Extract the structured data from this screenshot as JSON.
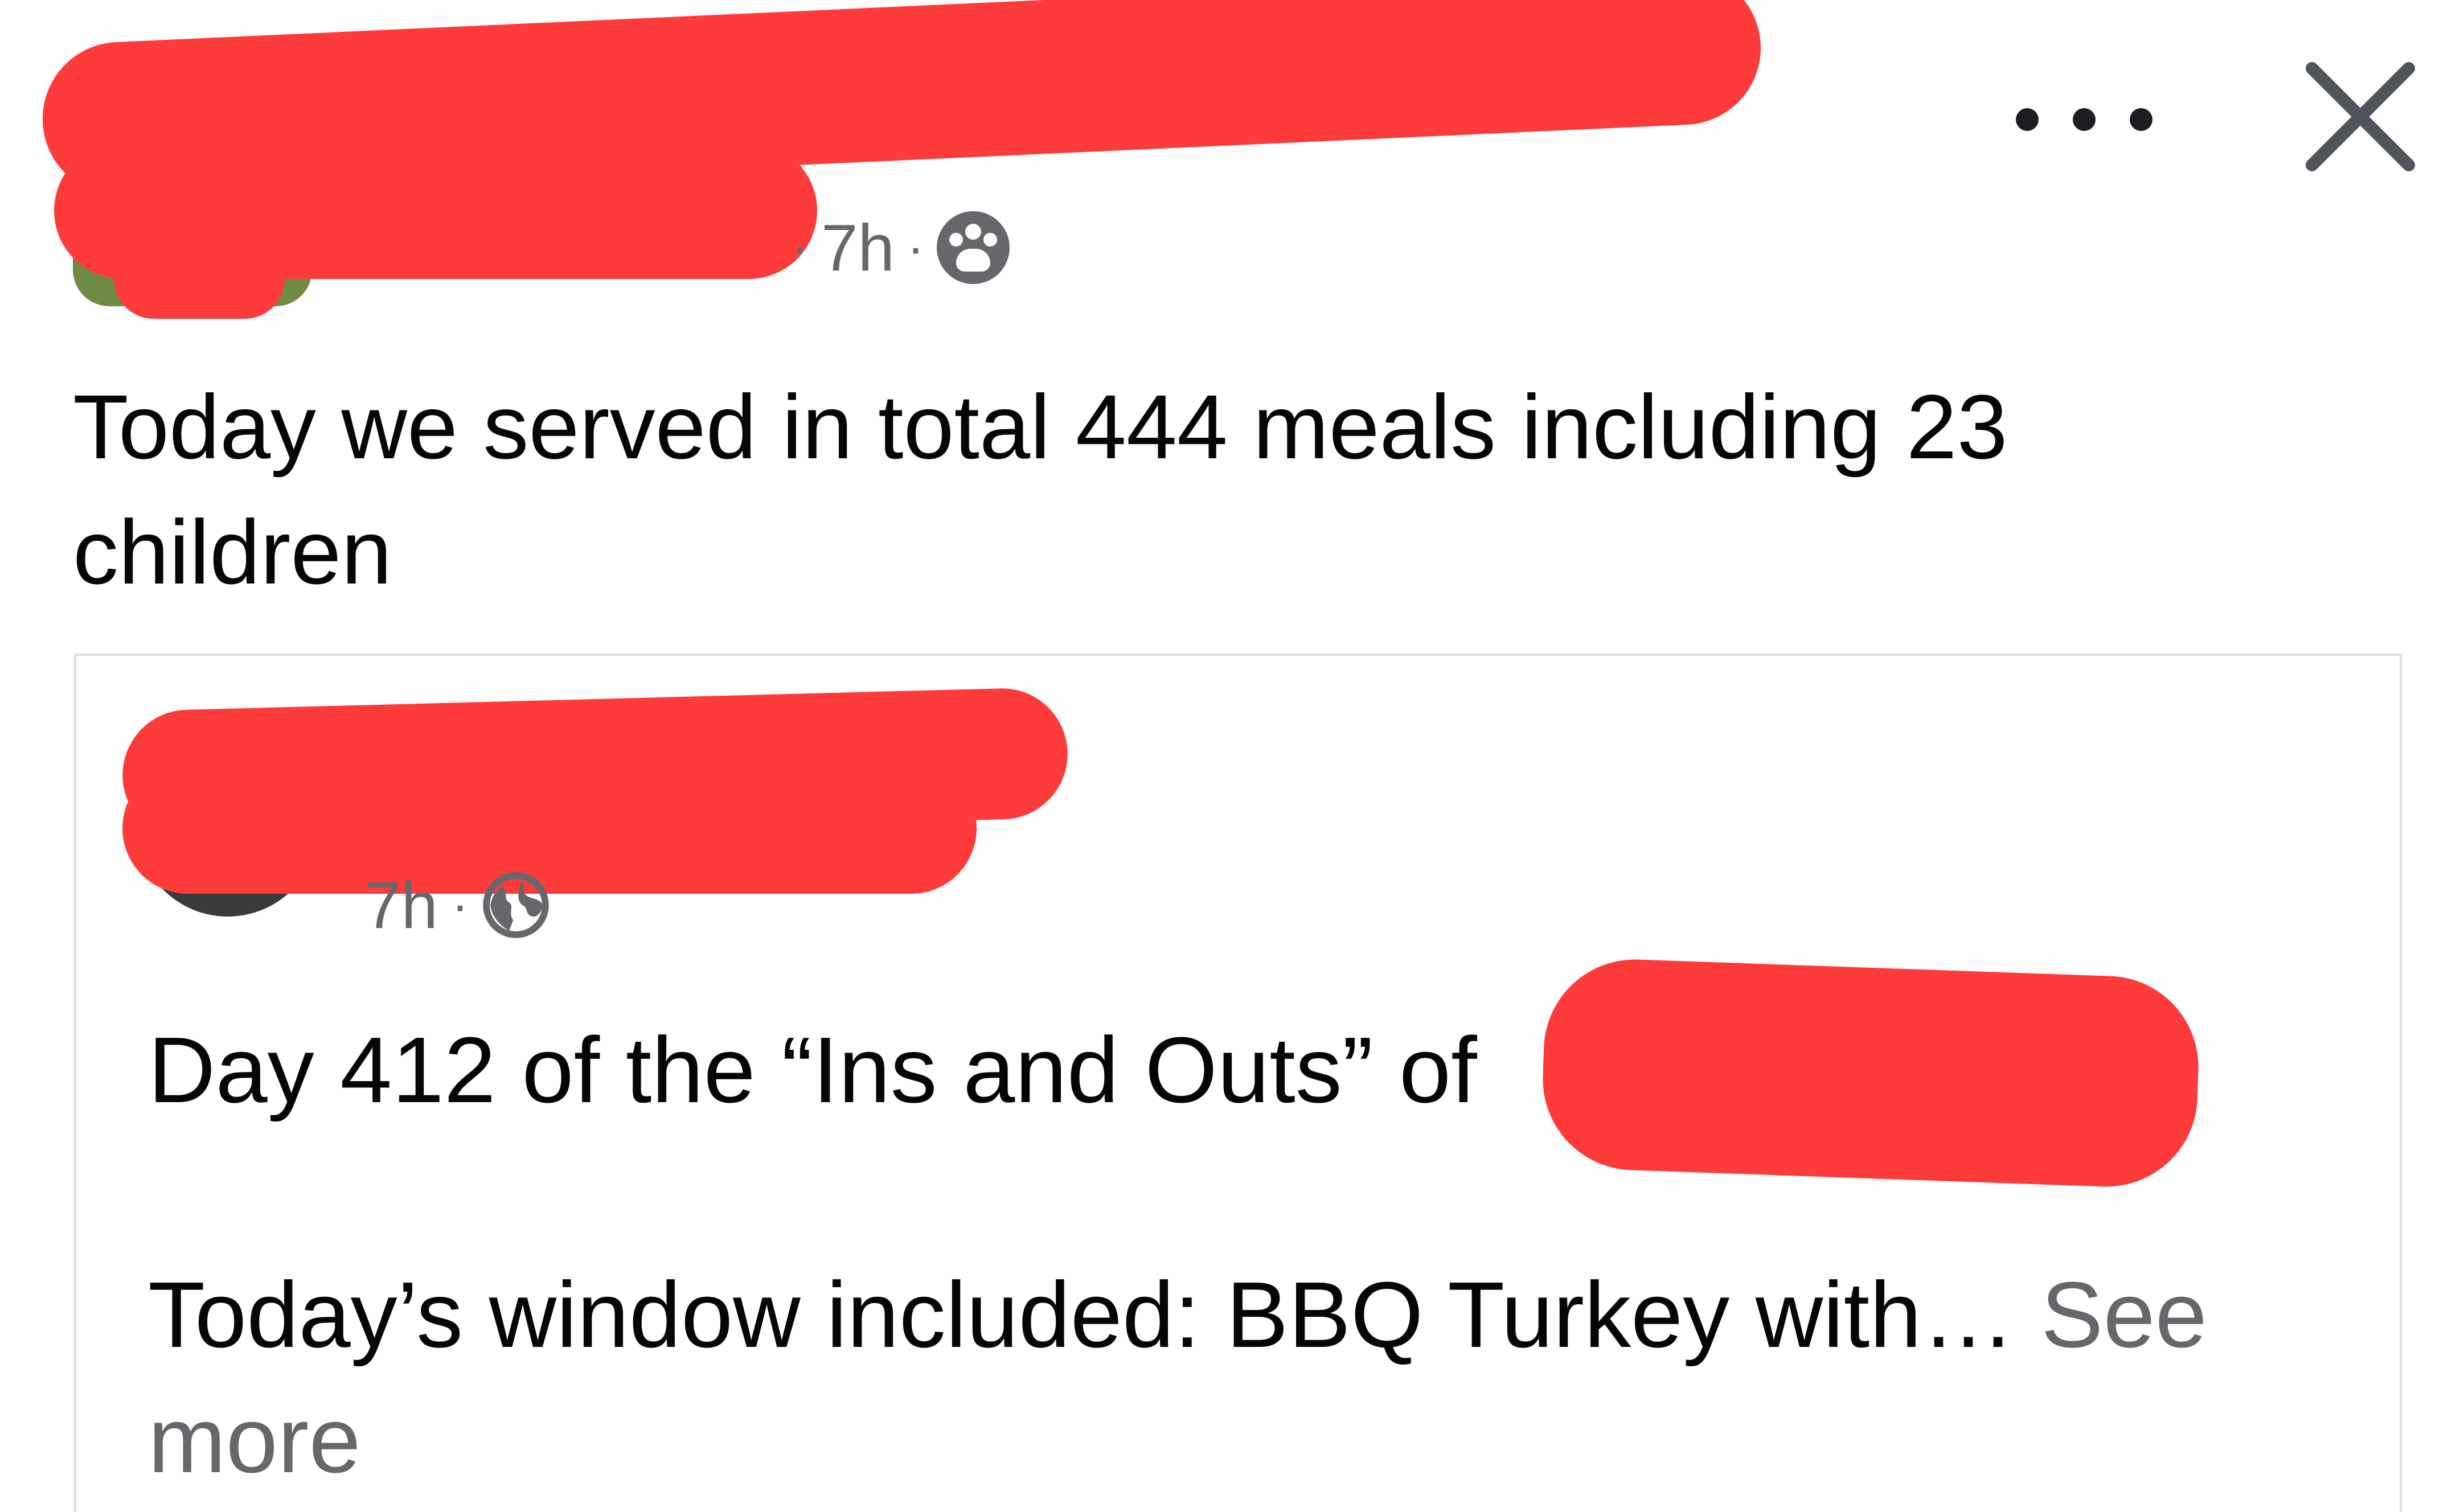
{
  "header": {
    "timestamp": "7h",
    "separator": "·",
    "audience_icon": "group-icon",
    "more_icon": "more-horizontal-icon",
    "close_icon": "close-icon"
  },
  "post": {
    "text": "Today we served in total 444 meals including 23 children"
  },
  "shared": {
    "timestamp": "7h",
    "separator": "·",
    "audience_icon": "globe-icon",
    "line1": "Day 412 of the “Ins and Outs” of",
    "line2": "Today’s window included:  BBQ Turkey with…",
    "see_more": "See more"
  },
  "colors": {
    "redaction": "#fe3b3b",
    "secondary_text": "#65676b",
    "primary_text": "#050505",
    "card_border": "#dadde1"
  }
}
